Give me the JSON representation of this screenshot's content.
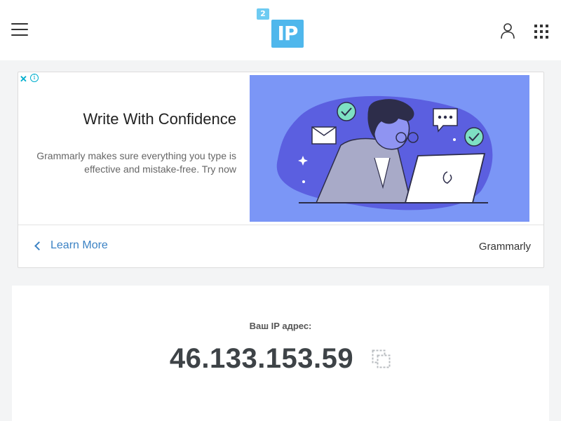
{
  "header": {
    "logo_badge": "2",
    "logo_text": "IP"
  },
  "ad": {
    "close_symbol": "✕",
    "info_symbol": "i",
    "title": "Write With Confidence",
    "description": "Grammarly makes sure everything you type is effective and mistake-free. Try now",
    "cta": "Learn More",
    "brand": "Grammarly"
  },
  "ip_card": {
    "label": "Ваш IP адрес:",
    "ip_address": "46.133.153.59"
  },
  "icons": {
    "menu": "hamburger-icon",
    "user": "user-icon",
    "apps": "apps-grid-icon",
    "copy": "copy-icon"
  },
  "colors": {
    "logo_blue": "#4fb7ec",
    "ad_image_bg": "#7b96f6",
    "link_blue": "#3b82c4",
    "ip_text": "#3e4347"
  }
}
